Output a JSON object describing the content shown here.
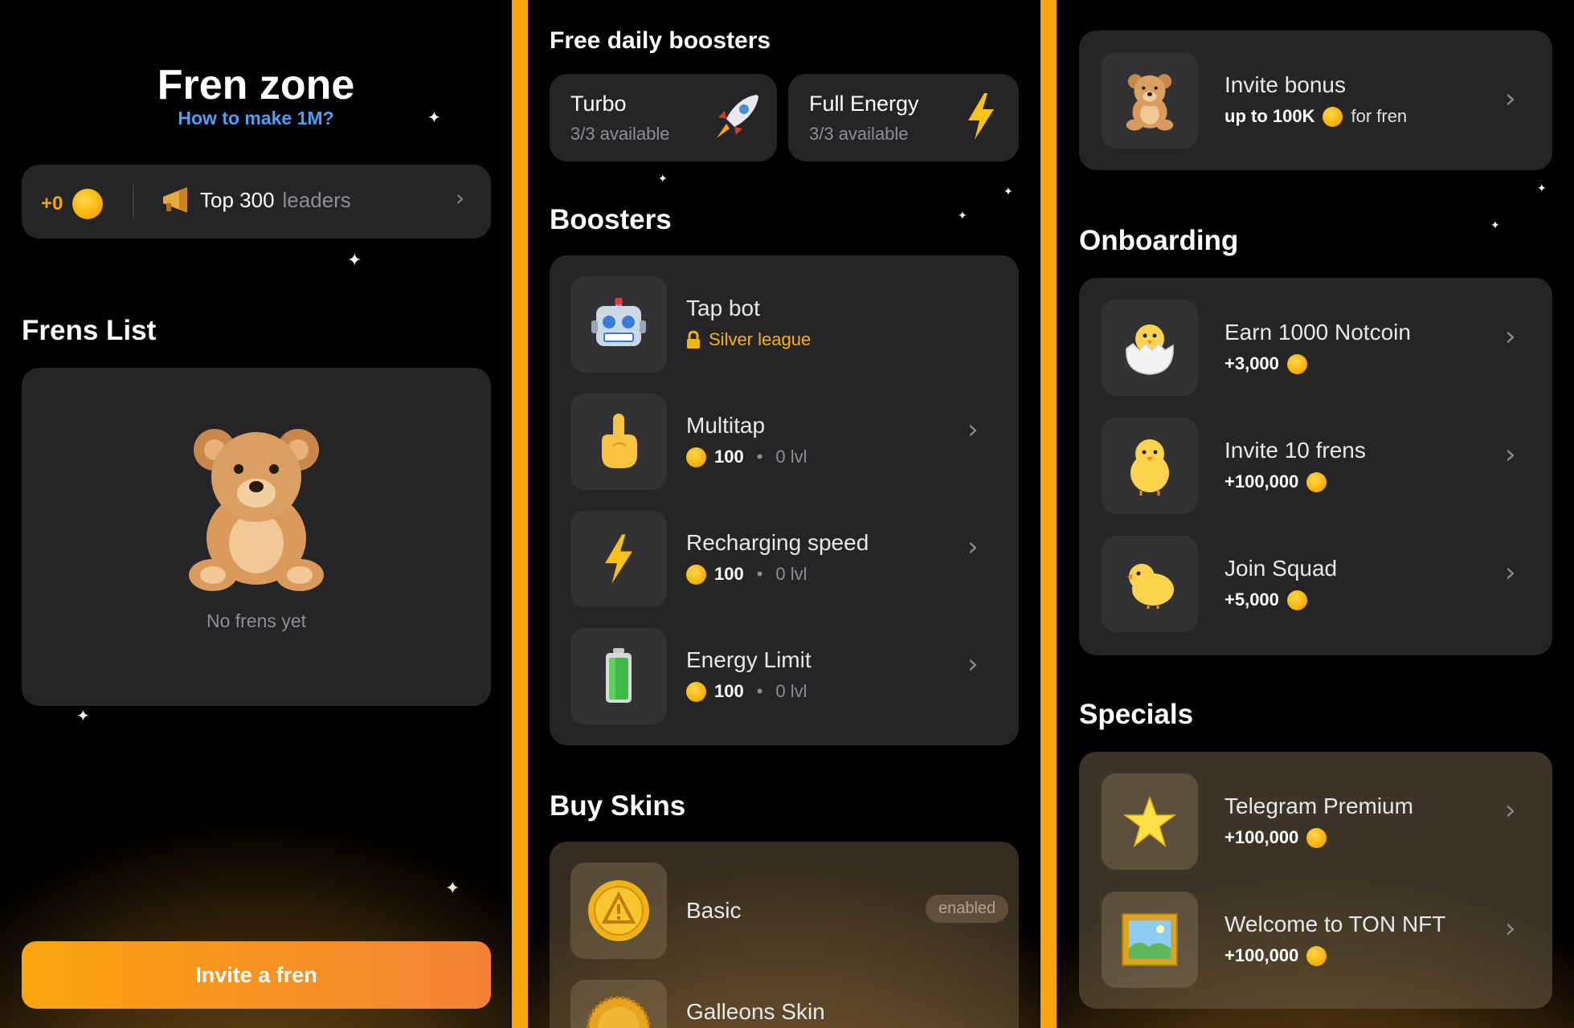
{
  "fren_zone": {
    "title": "Fren zone",
    "help_link": "How to make 1M?",
    "balance": "+0",
    "leaders_prefix": "Top 300",
    "leaders_suffix": "leaders",
    "frens_list_title": "Frens List",
    "empty_text": "No frens yet",
    "invite_button": "Invite a fren"
  },
  "boosts": {
    "free_title": "Free daily boosters",
    "free": [
      {
        "name": "Turbo",
        "availability": "3/3 available",
        "icon": "rocket-icon"
      },
      {
        "name": "Full Energy",
        "availability": "3/3 available",
        "icon": "lightning-icon"
      }
    ],
    "boosters_title": "Boosters",
    "boosters": [
      {
        "name": "Tap bot",
        "locked_label": "Silver league",
        "icon": "robot-icon"
      },
      {
        "name": "Multitap",
        "price": "100",
        "level": "0 lvl",
        "icon": "pointing-finger-icon"
      },
      {
        "name": "Recharging speed",
        "price": "100",
        "level": "0 lvl",
        "icon": "lightning-icon"
      },
      {
        "name": "Energy Limit",
        "price": "100",
        "level": "0 lvl",
        "icon": "battery-icon"
      }
    ],
    "skins_title": "Buy Skins",
    "skins": [
      {
        "name": "Basic",
        "status": "enabled",
        "icon": "basic-coin-icon"
      },
      {
        "name": "Galleons Skin",
        "icon": "galleon-coin-icon"
      }
    ]
  },
  "tasks": {
    "invite_bonus": {
      "title": "Invite bonus",
      "amount": "up to 100K",
      "suffix": "for fren",
      "icon": "teddy-bear-icon"
    },
    "onboarding_title": "Onboarding",
    "onboarding": [
      {
        "title": "Earn 1000 Notcoin",
        "reward": "+3,000",
        "icon": "hatching-chick-icon"
      },
      {
        "title": "Invite 10 frens",
        "reward": "+100,000",
        "icon": "chick-front-icon"
      },
      {
        "title": "Join Squad",
        "reward": "+5,000",
        "icon": "baby-chick-icon"
      }
    ],
    "specials_title": "Specials",
    "specials": [
      {
        "title": "Telegram Premium",
        "reward": "+100,000",
        "icon": "star-icon"
      },
      {
        "title": "Welcome to TON NFT",
        "reward": "+100,000",
        "icon": "framed-picture-icon"
      }
    ]
  },
  "colors": {
    "accent": "#f7a40d",
    "link": "#4f9ef7",
    "locked": "#f5b400",
    "card": "#2c2c2e"
  }
}
